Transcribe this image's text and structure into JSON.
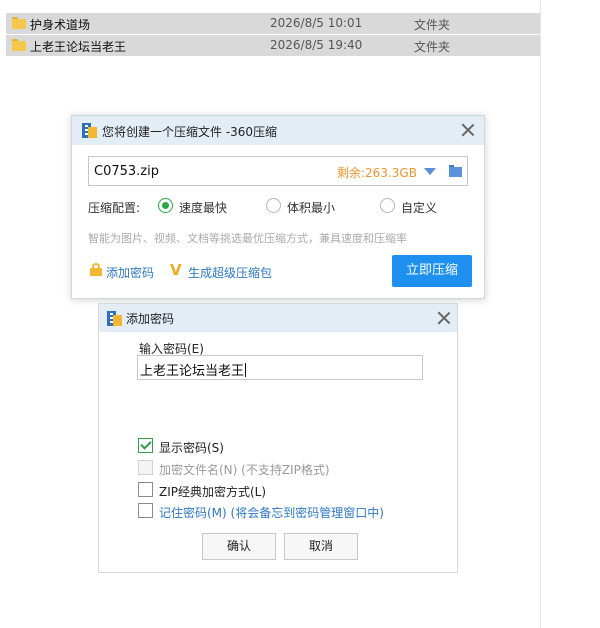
{
  "explorer": {
    "rows": [
      {
        "name": "护身术道场",
        "date": "2026/8/5 10:01",
        "type": "文件夹"
      },
      {
        "name": "上老王论坛当老王",
        "date": "2026/8/5 19:40",
        "type": "文件夹"
      }
    ]
  },
  "compress_dialog": {
    "title": "您将创建一个压缩文件 -360压缩",
    "path": "C0753.zip",
    "space_left": "剩余:263.3GB",
    "config_label": "压缩配置:",
    "options": [
      "速度最快",
      "体积最小",
      "自定义"
    ],
    "selected_option": "速度最快",
    "hint": "智能为图片、视频、文档等挑选最优压缩方式，兼具速度和压缩率",
    "add_password_link": "添加密码",
    "super_package_link": "生成超级压缩包",
    "compress_button": "立即压缩"
  },
  "password_dialog": {
    "title": "添加密码",
    "input_label": "输入密码(E)",
    "password_value": "上老王论坛当老王",
    "checkboxes": [
      {
        "label": "显示密码(S)",
        "checked": true,
        "enabled": true
      },
      {
        "label": "加密文件名(N) (不支持ZIP格式)",
        "checked": false,
        "enabled": false
      },
      {
        "label": "ZIP经典加密方式(L)",
        "checked": false,
        "enabled": true
      },
      {
        "label": "记住密码(M) (将会备忘到密码管理窗口中)",
        "checked": false,
        "enabled": true
      }
    ],
    "ok_button": "确认",
    "cancel_button": "取消"
  },
  "colors": {
    "accent_blue": "#1e90ef",
    "link_blue": "#2d79c7",
    "space_orange": "#f0932b",
    "check_green": "#2e9e48",
    "title_bar": "#e3edf6"
  },
  "icons": [
    "folder-icon",
    "app-icon-360zip",
    "close-icon",
    "dropdown-arrow-icon",
    "browse-folder-icon",
    "lock-icon",
    "v-icon"
  ]
}
